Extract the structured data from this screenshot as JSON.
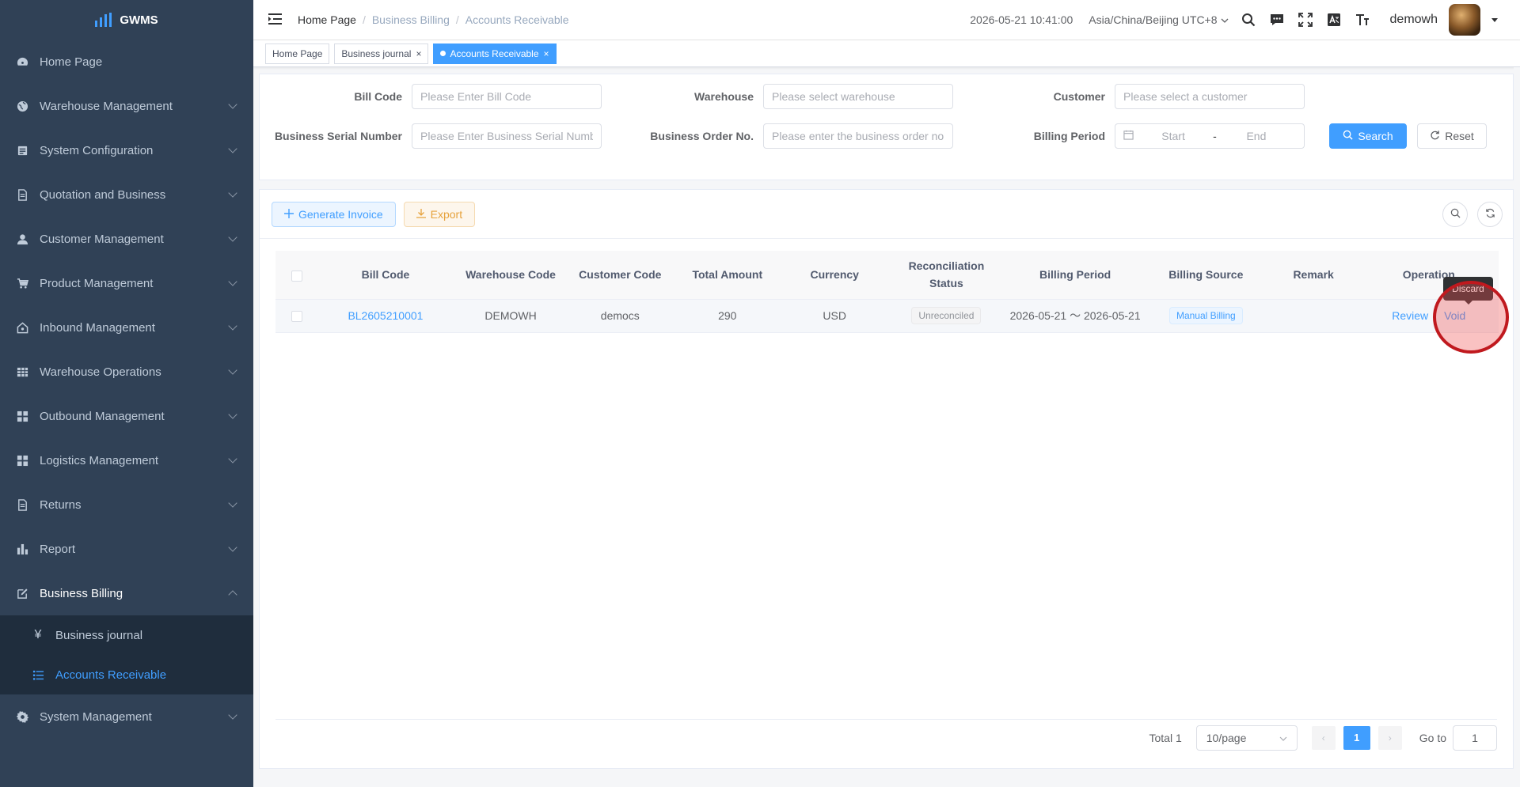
{
  "app": {
    "logo_text": "GWMS"
  },
  "sidebar": {
    "items": [
      {
        "label": "Home Page",
        "icon": "dashboard-icon"
      },
      {
        "label": "Warehouse Management",
        "icon": "globe-icon"
      },
      {
        "label": "System Configuration",
        "icon": "config-icon"
      },
      {
        "label": "Quotation and Business",
        "icon": "document-icon"
      },
      {
        "label": "Customer Management",
        "icon": "user-icon"
      },
      {
        "label": "Product Management",
        "icon": "cart-icon"
      },
      {
        "label": "Inbound Management",
        "icon": "house-icon"
      },
      {
        "label": "Warehouse Operations",
        "icon": "grid-icon"
      },
      {
        "label": "Outbound Management",
        "icon": "tiles-icon"
      },
      {
        "label": "Logistics Management",
        "icon": "tiles-icon"
      },
      {
        "label": "Returns",
        "icon": "document-icon"
      },
      {
        "label": "Report",
        "icon": "bar-chart-icon"
      },
      {
        "label": "Business Billing",
        "icon": "edit-icon"
      },
      {
        "label": "System Management",
        "icon": "gear-icon"
      }
    ],
    "billing_children": [
      {
        "label": "Business journal",
        "icon": "yen-icon"
      },
      {
        "label": "Accounts Receivable",
        "icon": "list-icon"
      }
    ]
  },
  "header": {
    "breadcrumb": [
      "Home Page",
      "Business Billing",
      "Accounts Receivable"
    ],
    "datetime": "2026-05-21 10:41:00",
    "timezone": "Asia/China/Beijing UTC+8",
    "username": "demowh"
  },
  "tags": [
    {
      "label": "Home Page"
    },
    {
      "label": "Business journal"
    },
    {
      "label": "Accounts Receivable"
    }
  ],
  "filters": {
    "bill_code": {
      "label": "Bill Code",
      "placeholder": "Please Enter Bill Code"
    },
    "warehouse": {
      "label": "Warehouse",
      "placeholder": "Please select warehouse"
    },
    "customer": {
      "label": "Customer",
      "placeholder": "Please select a customer"
    },
    "serial": {
      "label": "Business Serial Number",
      "placeholder": "Please Enter Business Serial Number"
    },
    "order_no": {
      "label": "Business Order No.",
      "placeholder": "Please enter the business order no."
    },
    "billing_period": {
      "label": "Billing Period",
      "start": "Start",
      "sep": "-",
      "end": "End"
    },
    "search_label": "Search",
    "reset_label": "Reset"
  },
  "toolbar": {
    "generate_label": "Generate Invoice",
    "export_label": "Export"
  },
  "table": {
    "columns": [
      "Bill Code",
      "Warehouse Code",
      "Customer Code",
      "Total Amount",
      "Currency",
      "Reconciliation Status",
      "Billing Period",
      "Billing Source",
      "Remark",
      "Operation"
    ],
    "rows": [
      {
        "bill_code": "BL2605210001",
        "warehouse_code": "DEMOWH",
        "customer_code": "democs",
        "total_amount": "290",
        "currency": "USD",
        "status": "Unreconciled",
        "billing_period": "2026-05-21 ～ 2026-05-21",
        "source": "Manual Billing",
        "remark": "",
        "op_review": "Review",
        "op_void": "Void"
      }
    ]
  },
  "tooltip": {
    "text": "Discard"
  },
  "pagination": {
    "total": "Total 1",
    "page_size": "10/page",
    "current_page": "1",
    "goto_label": "Go to",
    "goto_value": "1"
  },
  "colors": {
    "sidebar_bg": "#304156",
    "primary": "#409eff",
    "warning": "#e6a23c",
    "marker": "#c0191e"
  }
}
